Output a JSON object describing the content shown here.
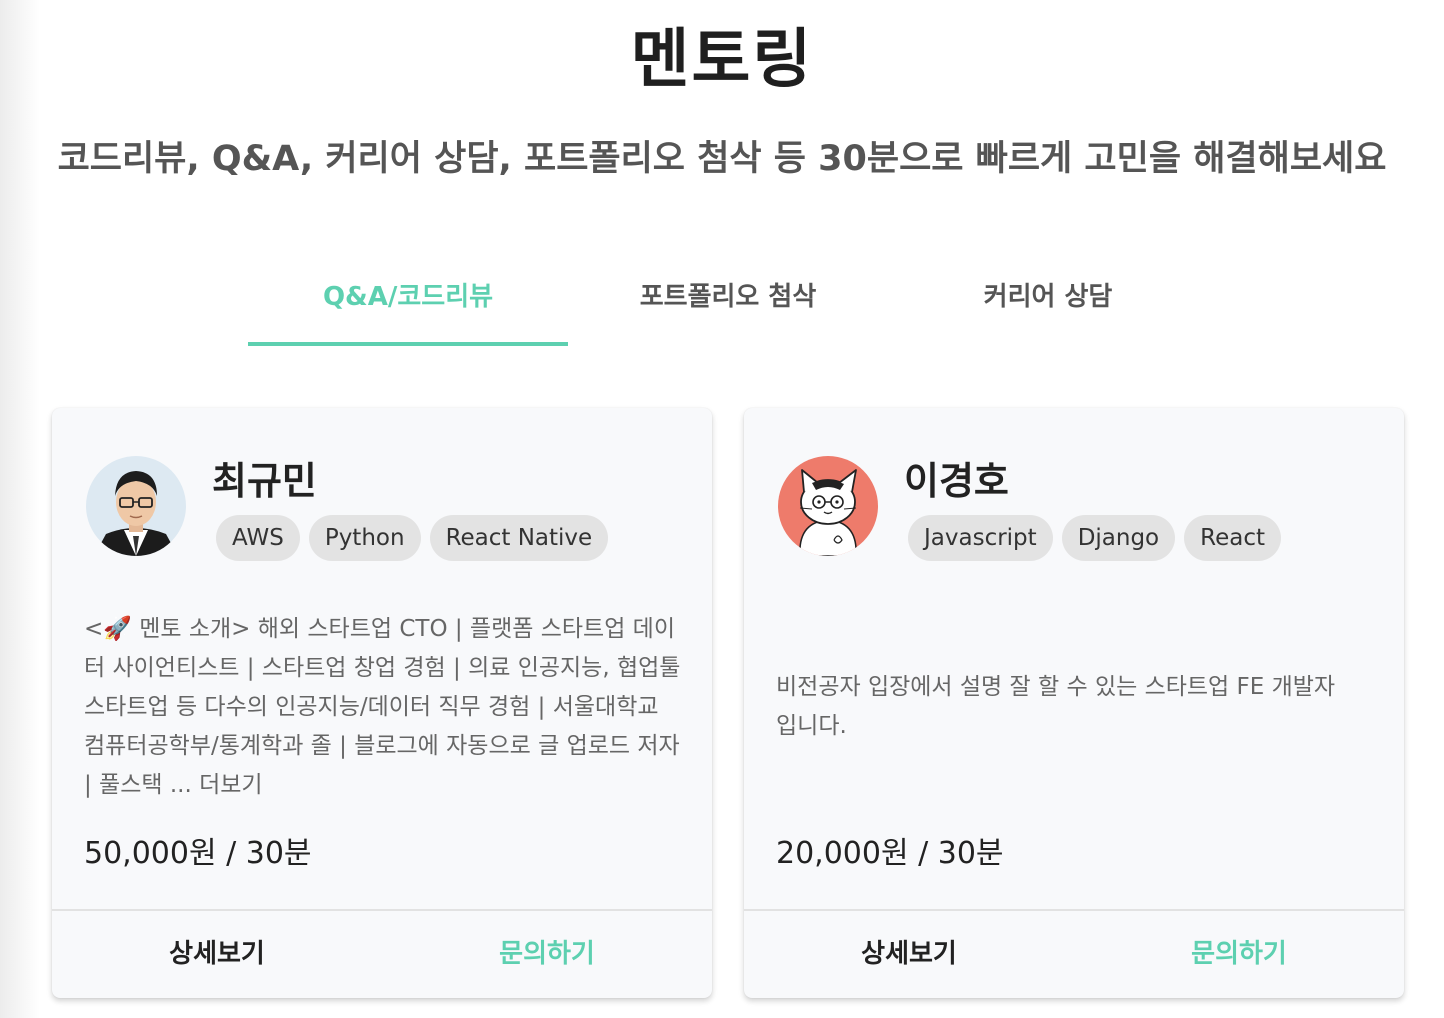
{
  "header": {
    "title": "멘토링",
    "subtitle": "코드리뷰, Q&A, 커리어 상담, 포트폴리오 첨삭 등 30분으로 빠르게 고민을 해결해보세요"
  },
  "tabs": [
    {
      "label": "Q&A/코드리뷰",
      "active": true
    },
    {
      "label": "포트폴리오 첨삭",
      "active": false
    },
    {
      "label": "커리어 상담",
      "active": false
    }
  ],
  "colors": {
    "accent": "#5dd0b0",
    "tag_bg": "#e3e3e3",
    "card_bg": "#f8f9fb"
  },
  "mentors": [
    {
      "name": "최규민",
      "avatar_icon": "person-photo-icon",
      "tags": [
        "AWS",
        "Python",
        "React Native"
      ],
      "description": "<🚀 멘토 소개> 해외 스타트업 CTO | 플랫폼 스타트업 데이터 사이언티스트 | 스타트업 창업 경험 | 의료 인공지능, 협업툴 스타트업 등 다수의 인공지능/데이터 직무 경험 | 서울대학교 컴퓨터공학부/통계학과 졸 | 블로그에 자동으로 글 업로드 저자 | 풀스택 ... 더보기",
      "price": "50,000원 / 30분",
      "detail_label": "상세보기",
      "inquire_label": "문의하기"
    },
    {
      "name": "이경호",
      "avatar_icon": "cat-illustration-icon",
      "tags": [
        "Javascript",
        "Django",
        "React"
      ],
      "description": "비전공자 입장에서 설명 잘 할 수 있는 스타트업 FE 개발자입니다.",
      "price": "20,000원 / 30분",
      "detail_label": "상세보기",
      "inquire_label": "문의하기"
    }
  ]
}
